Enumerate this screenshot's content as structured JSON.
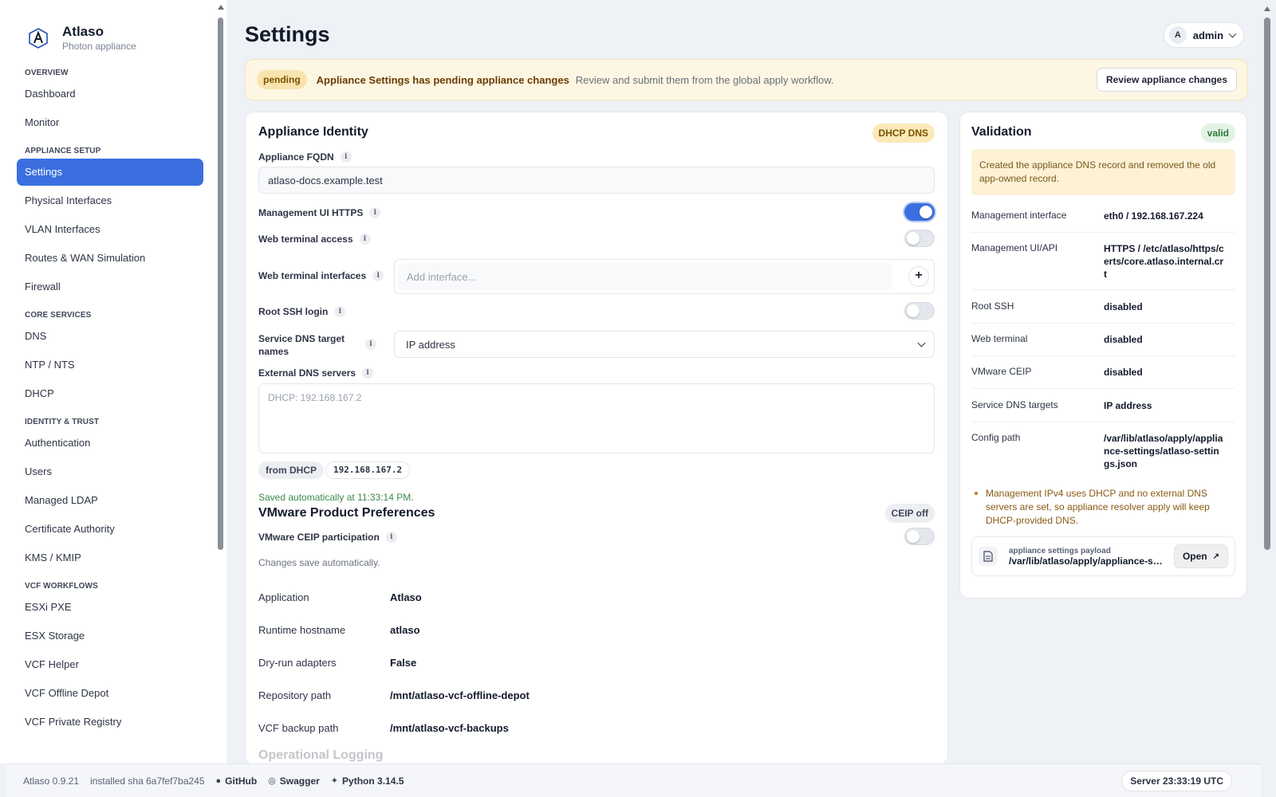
{
  "brand": {
    "name": "Atlaso",
    "subtitle": "Photon appliance"
  },
  "nav": {
    "sections": [
      {
        "title": "Overview",
        "items": [
          "Dashboard",
          "Monitor"
        ]
      },
      {
        "title": "Appliance Setup",
        "items": [
          "Settings",
          "Physical Interfaces",
          "VLAN Interfaces",
          "Routes & WAN Simulation",
          "Firewall"
        ]
      },
      {
        "title": "Core Services",
        "items": [
          "DNS",
          "NTP / NTS",
          "DHCP"
        ]
      },
      {
        "title": "Identity & Trust",
        "items": [
          "Authentication",
          "Users",
          "Managed LDAP",
          "Certificate Authority",
          "KMS / KMIP"
        ]
      },
      {
        "title": "VCF Workflows",
        "items": [
          "ESXi PXE",
          "ESX Storage",
          "VCF Helper",
          "VCF Offline Depot",
          "VCF Private Registry"
        ]
      }
    ],
    "active": "Settings"
  },
  "header": {
    "title": "Settings",
    "user_initial": "A",
    "user_name": "admin"
  },
  "banner": {
    "badge": "pending",
    "title": "Appliance Settings has pending appliance changes",
    "description": "Review and submit them from the global apply workflow.",
    "button": "Review appliance changes"
  },
  "identity": {
    "title": "Appliance Identity",
    "tag": "DHCP DNS",
    "fqdn_label": "Appliance FQDN",
    "fqdn_value": "atlaso-docs.example.test",
    "https_label": "Management UI HTTPS",
    "https_on": true,
    "web_terminal_label": "Web terminal access",
    "web_terminal_on": false,
    "web_terminal_ifaces_label": "Web terminal interfaces",
    "web_terminal_ifaces_placeholder": "Add interface...",
    "root_ssh_label": "Root SSH login",
    "root_ssh_on": false,
    "dns_target_label": "Service DNS target names",
    "dns_target_value": "IP address",
    "ext_dns_label": "External DNS servers",
    "ext_dns_placeholder": "DHCP: 192.168.167.2",
    "dhcp_chip": "from DHCP",
    "dhcp_ip": "192.168.167.2",
    "saved_note": "Saved automatically at 11:33:14 PM."
  },
  "vmware": {
    "title": "VMware Product Preferences",
    "tag": "CEIP off",
    "ceip_label": "VMware CEIP participation",
    "ceip_on": false,
    "note": "Changes save automatically.",
    "rows": [
      {
        "key": "Application",
        "value": "Atlaso"
      },
      {
        "key": "Runtime hostname",
        "value": "atlaso"
      },
      {
        "key": "Dry-run adapters",
        "value": "False"
      },
      {
        "key": "Repository path",
        "value": "/mnt/atlaso-vcf-offline-depot"
      },
      {
        "key": "VCF backup path",
        "value": "/mnt/atlaso-vcf-backups"
      }
    ],
    "next_section": "Operational Logging"
  },
  "validation": {
    "title": "Validation",
    "tag": "valid",
    "message": "Created the appliance DNS record and removed the old app-owned record.",
    "rows": [
      {
        "key": "Management interface",
        "value": "eth0 / 192.168.167.224"
      },
      {
        "key": "Management UI/API",
        "value": "HTTPS / /etc/atlaso/https/certs/core.atlaso.internal.crt"
      },
      {
        "key": "Root SSH",
        "value": "disabled"
      },
      {
        "key": "Web terminal",
        "value": "disabled"
      },
      {
        "key": "VMware CEIP",
        "value": "disabled"
      },
      {
        "key": "Service DNS targets",
        "value": "IP address"
      },
      {
        "key": "Config path",
        "value": "/var/lib/atlaso/apply/appliance-settings/atlaso-settings.json"
      }
    ],
    "warning": "Management IPv4 uses DHCP and no external DNS servers are set, so appliance resolver apply will keep DHCP-provided DNS.",
    "payload_label": "appliance settings payload",
    "payload_path": "/var/lib/atlaso/apply/appliance-settings/atlaso-settings.json",
    "open_button": "Open"
  },
  "footer": {
    "version": "Atlaso 0.9.21",
    "sha": "installed sha 6a7fef7ba245",
    "github": "GitHub",
    "swagger": "Swagger",
    "python": "Python 3.14.5",
    "server_time": "Server 23:33:19 UTC"
  },
  "colors": {
    "accent": "#3b6fe0",
    "pending": "#f7e4ae",
    "valid": "#e2f3e5"
  }
}
